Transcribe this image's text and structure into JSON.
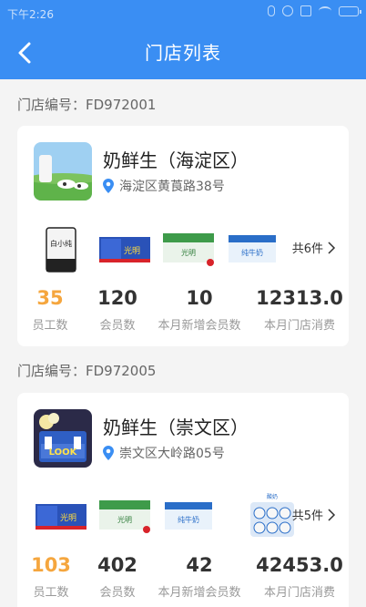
{
  "status": {
    "time": "下午2:26"
  },
  "header": {
    "title": "门店列表"
  },
  "stores": [
    {
      "number_label": "门店编号：FD972001",
      "name": "奶鲜生（海淀区）",
      "address": "海淀区黄莨路38号",
      "more_label": "共6件",
      "stats": [
        {
          "value": "35",
          "label": "员工数"
        },
        {
          "value": "120",
          "label": "会员数"
        },
        {
          "value": "10",
          "label": "本月新增会员数"
        },
        {
          "value": "12313.0",
          "label": "本月门店消费"
        }
      ],
      "product_labels": [
        "白小纯",
        "光明",
        "光明",
        "纯牛奶"
      ]
    },
    {
      "number_label": "门店编号：FD972005",
      "name": "奶鲜生（崇文区）",
      "address": "崇文区大岭路05号",
      "more_label": "共5件",
      "stats": [
        {
          "value": "103",
          "label": "员工数"
        },
        {
          "value": "402",
          "label": "会员数"
        },
        {
          "value": "42",
          "label": "本月新增会员数"
        },
        {
          "value": "42453.0",
          "label": "本月门店消费"
        }
      ],
      "product_labels": [
        "光明",
        "光明",
        "纯牛奶",
        "酸奶"
      ]
    }
  ],
  "colors": {
    "primary": "#3a8ef3",
    "accent": "#f5a63e",
    "pin": "#3a8ef3"
  }
}
